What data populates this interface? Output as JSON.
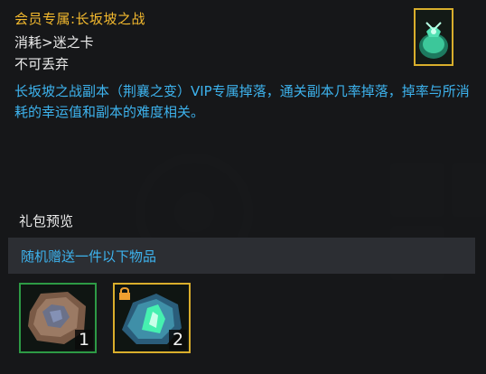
{
  "item": {
    "title": "会员专属:长坂坡之战",
    "consume": "消耗>迷之卡",
    "binding": "不可丢弃",
    "description": "长坂坡之战副本（荆襄之变）VIP专属掉落，通关副本几率掉落，掉率与所消耗的幸运值和副本的难度相关。",
    "icon": "gift-bag-icon"
  },
  "preview": {
    "label": "礼包预览",
    "band_text": "随机赠送一件以下物品",
    "rewards": [
      {
        "icon": "ore-stone-icon",
        "count": "1",
        "rarity_color": "#2d9a45"
      },
      {
        "icon": "green-crystal-icon",
        "count": "2",
        "rarity_color": "#d9ae2c",
        "locked": true
      }
    ]
  },
  "colors": {
    "title": "#f4ba2e",
    "description": "#3db3ee",
    "text": "#ececec"
  }
}
